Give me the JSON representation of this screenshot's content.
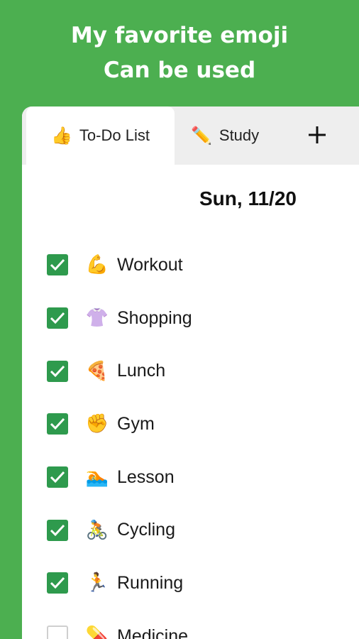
{
  "headline": {
    "line1": "My favorite emoji",
    "line2": "Can be used"
  },
  "tabs": [
    {
      "emoji": "👍",
      "label": "To-Do List",
      "active": true
    },
    {
      "emoji": "✏️",
      "label": "Study",
      "active": false
    }
  ],
  "add_tab_icon": "plus-icon",
  "date": "Sun, 11/20",
  "items": [
    {
      "emoji": "💪",
      "label": "Workout",
      "checked": true
    },
    {
      "emoji": "👚",
      "label": "Shopping",
      "checked": true
    },
    {
      "emoji": "🍕",
      "label": "Lunch",
      "checked": true
    },
    {
      "emoji": "✊",
      "label": "Gym",
      "checked": true
    },
    {
      "emoji": "🏊",
      "label": "Lesson",
      "checked": true
    },
    {
      "emoji": "🚴",
      "label": "Cycling",
      "checked": true
    },
    {
      "emoji": "🏃",
      "label": "Running",
      "checked": true
    },
    {
      "emoji": "💊",
      "label": "Medicine",
      "checked": false
    }
  ],
  "colors": {
    "background": "#4caf50",
    "checkbox_checked": "#2e9a4d",
    "tabbar": "#eeeeee"
  }
}
